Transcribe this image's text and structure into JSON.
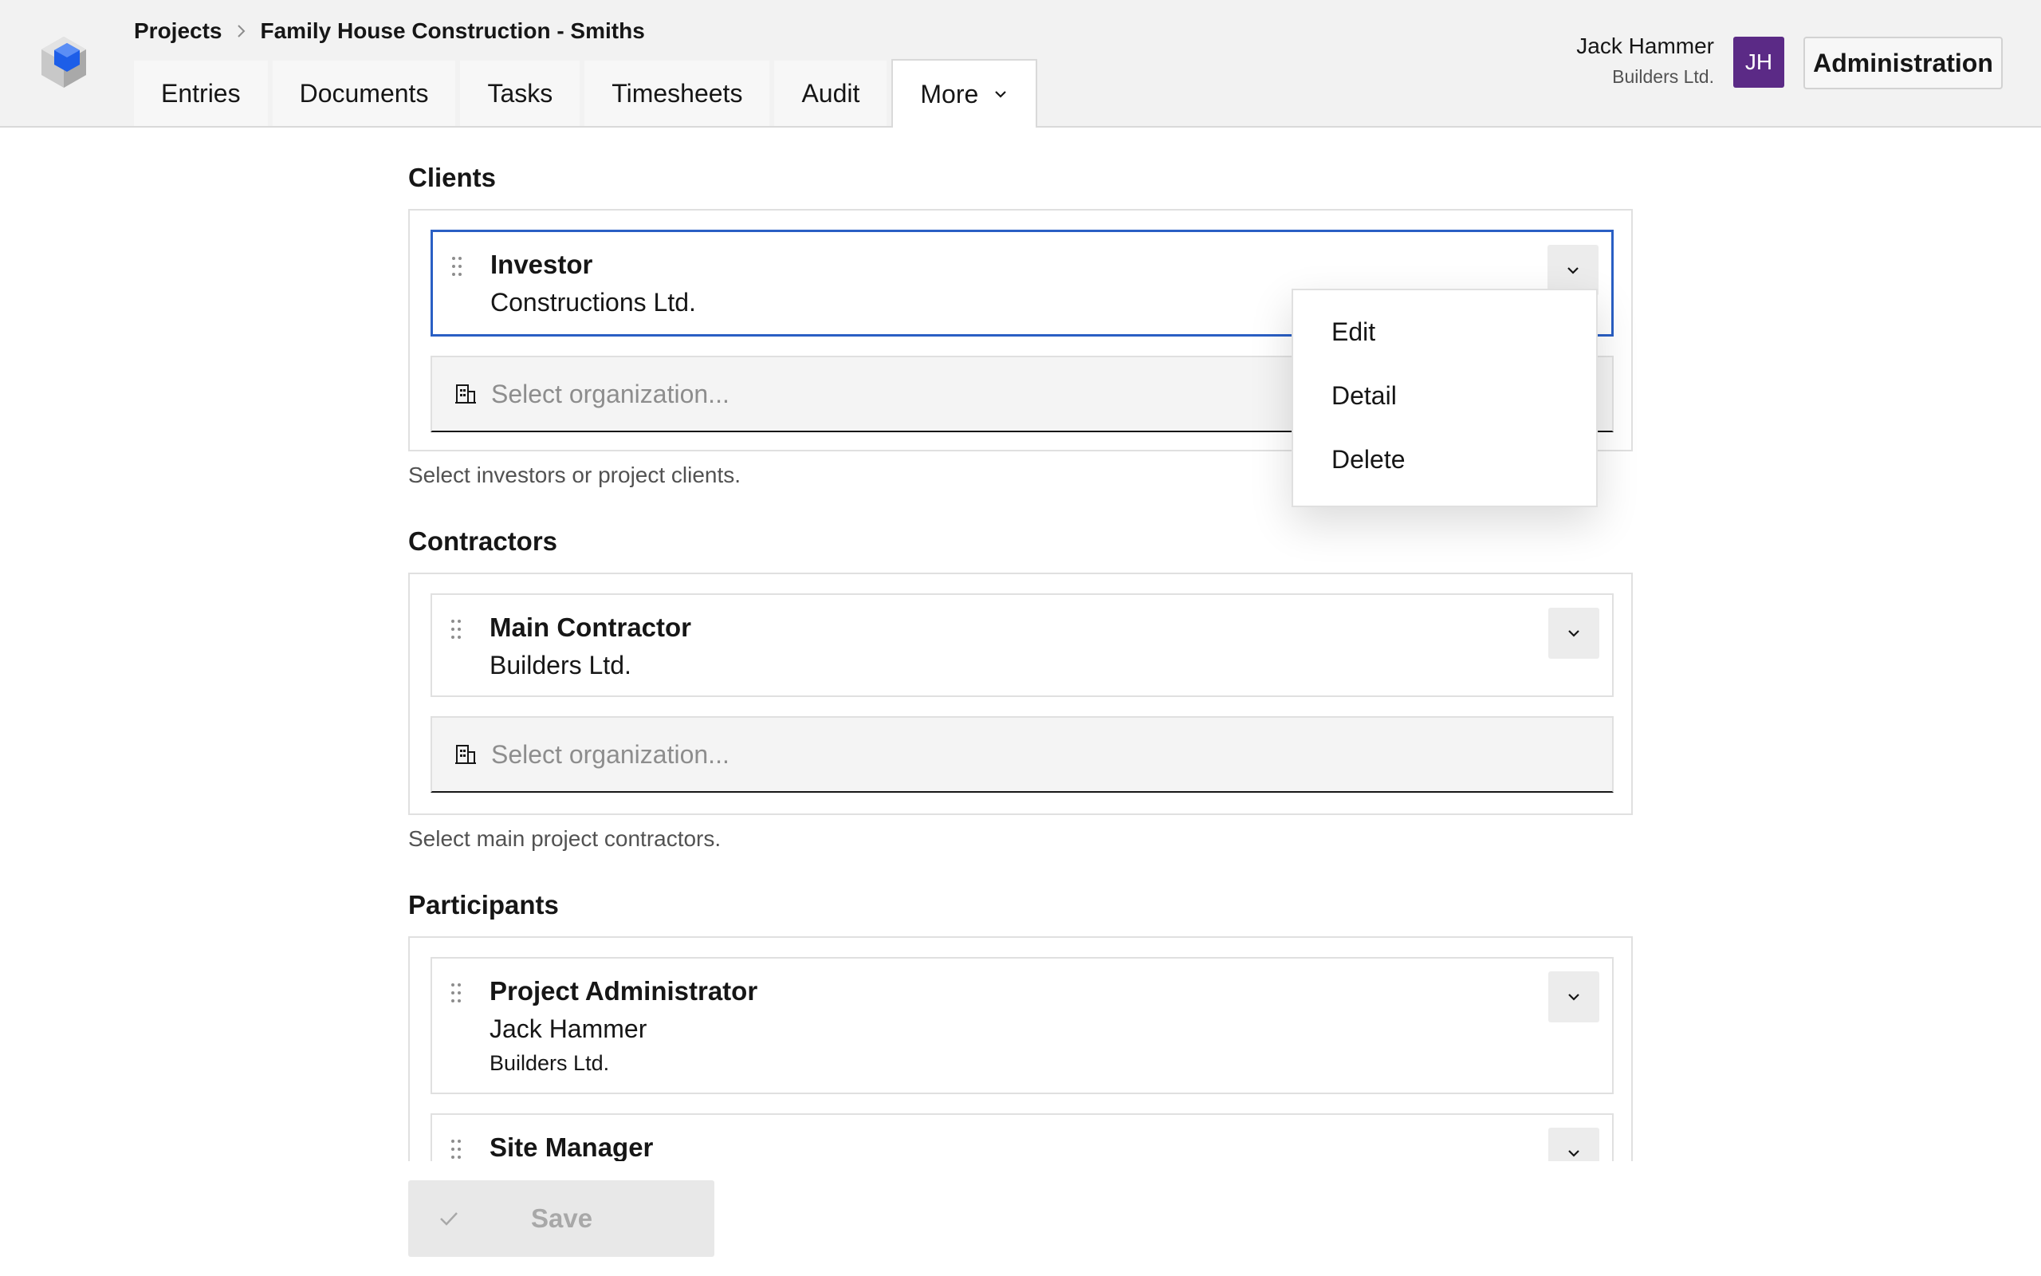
{
  "breadcrumb": {
    "root": "Projects",
    "current": "Family House Construction - Smiths"
  },
  "tabs": [
    {
      "label": "Entries"
    },
    {
      "label": "Documents"
    },
    {
      "label": "Tasks"
    },
    {
      "label": "Timesheets"
    },
    {
      "label": "Audit"
    },
    {
      "label": "More",
      "active": true
    }
  ],
  "user": {
    "name": "Jack Hammer",
    "org": "Builders Ltd.",
    "initials": "JH",
    "avatar_color": "#5b2a86"
  },
  "header": {
    "admin_label": "Administration"
  },
  "clients": {
    "title": "Clients",
    "items": [
      {
        "role": "Investor",
        "name": "Constructions Ltd."
      }
    ],
    "select_placeholder": "Select organization...",
    "helper": "Select investors or project clients."
  },
  "contractors": {
    "title": "Contractors",
    "items": [
      {
        "role": "Main Contractor",
        "name": "Builders Ltd."
      }
    ],
    "select_placeholder": "Select organization...",
    "helper": "Select main project contractors."
  },
  "participants": {
    "title": "Participants",
    "items": [
      {
        "role": "Project Administrator",
        "name": "Jack Hammer",
        "org": "Builders Ltd."
      },
      {
        "role": "Site Manager"
      }
    ]
  },
  "menu": {
    "items": [
      "Edit",
      "Detail",
      "Delete"
    ]
  },
  "save": {
    "label": "Save"
  },
  "colors": {
    "focus": "#2a5fc4",
    "logo_blue": "#1d5ee8"
  },
  "icons": {
    "logo": "cube-logo",
    "breadcrumb_sep": "chevron-right-icon",
    "tab_more": "chevron-down-icon",
    "drag": "drag-handle-icon",
    "item_menu": "chevron-down-icon",
    "select": "building-icon",
    "save": "checkmark-icon"
  }
}
